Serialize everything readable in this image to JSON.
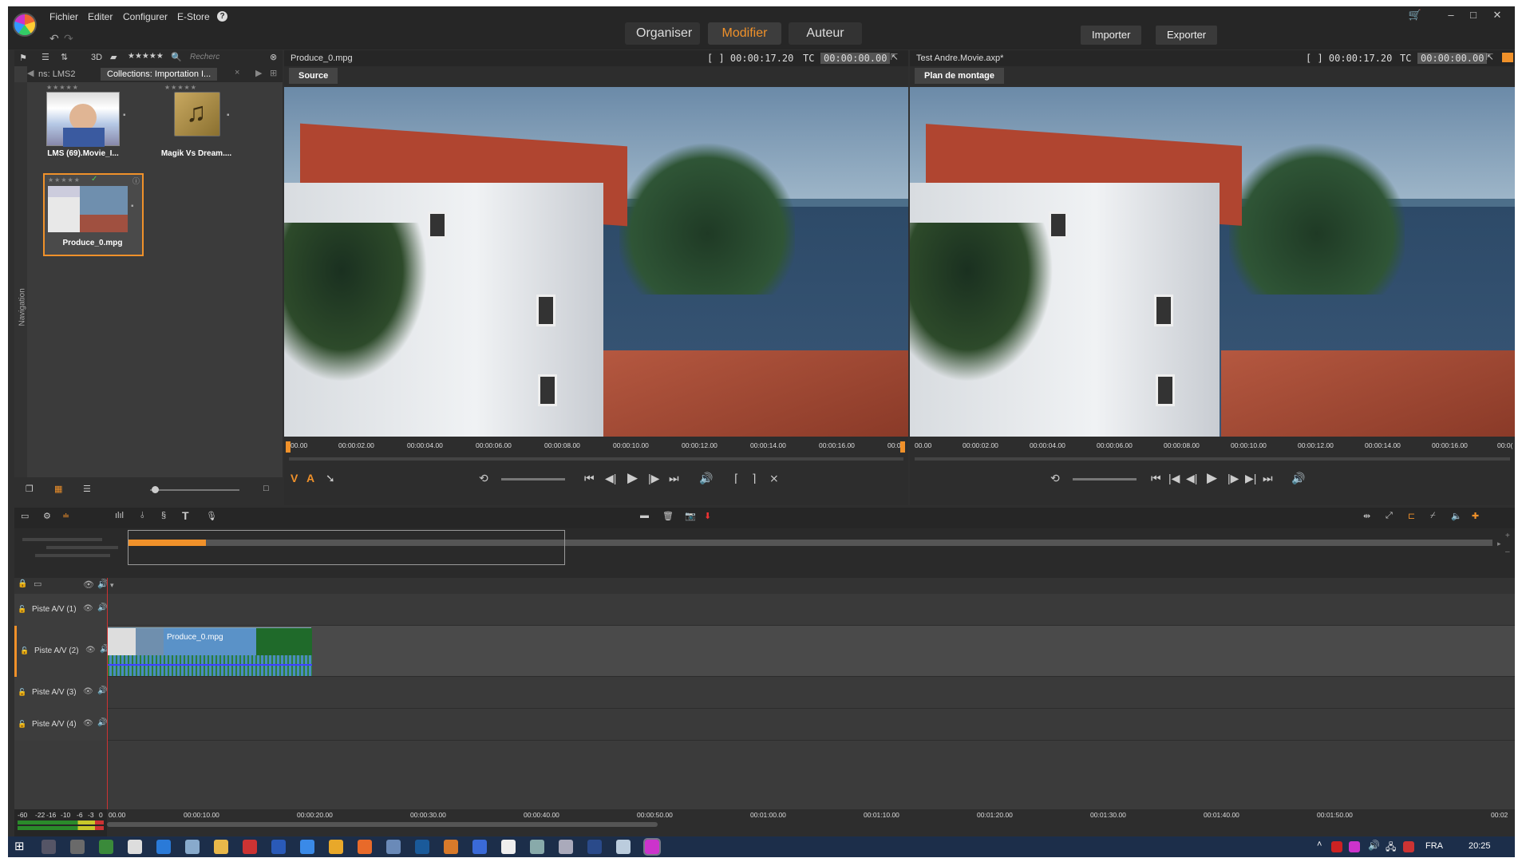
{
  "menu": {
    "file": "Fichier",
    "edit": "Editer",
    "configure": "Configurer",
    "estore": "E-Store",
    "help": "?"
  },
  "modes": {
    "organize": "Organiser",
    "edit": "Modifier",
    "author": "Auteur"
  },
  "actions": {
    "import": "Importer",
    "export": "Exporter"
  },
  "library": {
    "tab_left": "ns: LMS2",
    "tab_active": "Collections: Importation I...",
    "nav_label": "Navigation",
    "search_placeholder": "Recherc",
    "view_3d": "3D",
    "items": [
      {
        "label": "LMS (69).Movie_I..."
      },
      {
        "label": "Magik Vs Dream...."
      },
      {
        "label": "Produce_0.mpg"
      }
    ]
  },
  "source_viewer": {
    "title": "Produce_0.mpg",
    "duration": "[ ] 00:00:17.20",
    "tc_label": "TC",
    "tc_value": "00:00:00.00",
    "tab": "Source",
    "ticks": [
      "00.00",
      "00:00:02.00",
      "00:00:04.00",
      "00:00:06.00",
      "00:00:08.00",
      "00:00:10.00",
      "00:00:12.00",
      "00:00:14.00",
      "00:00:16.00",
      "00:0"
    ]
  },
  "timeline_viewer": {
    "title": "Test Andre.Movie.axp*",
    "duration": "[ ] 00:00:17.20",
    "tc_label": "TC",
    "tc_value": "00:00:00.00",
    "tab": "Plan de montage",
    "ticks": [
      "00.00",
      "00:00:02.00",
      "00:00:04.00",
      "00:00:06.00",
      "00:00:08.00",
      "00:00:10.00",
      "00:00:12.00",
      "00:00:14.00",
      "00:00:16.00",
      "00:0("
    ]
  },
  "tracks": [
    {
      "label": "Piste A/V (1)"
    },
    {
      "label": "Piste A/V (2)"
    },
    {
      "label": "Piste A/V (3)"
    },
    {
      "label": "Piste A/V (4)"
    }
  ],
  "clip": {
    "label": "Produce_0.mpg"
  },
  "tl_ruler": {
    "ticks": [
      "00.00",
      "00:00:10.00",
      "00:00:20.00",
      "00:00:30.00",
      "00:00:40.00",
      "00:00:50.00",
      "00:01:00.00",
      "00:01:10.00",
      "00:01:20.00",
      "00:01:30.00",
      "00:01:40.00",
      "00:01:50.00",
      "00:02"
    ],
    "meter": [
      "-60",
      "-22",
      "-16",
      "-10",
      "-6",
      "-3",
      "0"
    ]
  },
  "taskbar": {
    "lang": "FRA",
    "time": "20:25"
  },
  "colors": {
    "accent": "#f0912a",
    "bg": "#2f2f2f"
  }
}
